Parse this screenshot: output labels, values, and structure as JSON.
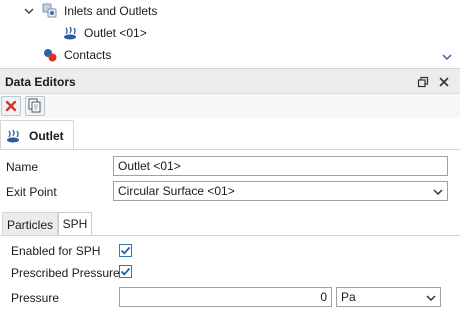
{
  "tree": {
    "items": [
      {
        "label": "Inlets and Outlets"
      },
      {
        "label": "Outlet <01>"
      },
      {
        "label": "Contacts"
      }
    ]
  },
  "panel": {
    "title": "Data Editors"
  },
  "object_tab": {
    "label": "Outlet"
  },
  "form": {
    "name_label": "Name",
    "name_value": "Outlet <01>",
    "exit_label": "Exit Point",
    "exit_value": "Circular Surface <01>"
  },
  "subtabs": [
    {
      "label": "Particles"
    },
    {
      "label": "SPH"
    }
  ],
  "sph": {
    "enabled_label": "Enabled for SPH",
    "enabled_checked": true,
    "prescribed_label": "Prescribed Pressure",
    "prescribed_checked": true,
    "pressure_label": "Pressure",
    "pressure_value": "0",
    "pressure_unit": "Pa"
  },
  "colors": {
    "accent": "#1f5fae",
    "close_red": "#d9322b"
  },
  "icons": [
    "chevron-down-icon",
    "inlets-outlets-icon",
    "outlet-icon",
    "contacts-icon",
    "restore-icon",
    "close-icon",
    "delete-icon",
    "copy-icon",
    "check-icon"
  ]
}
